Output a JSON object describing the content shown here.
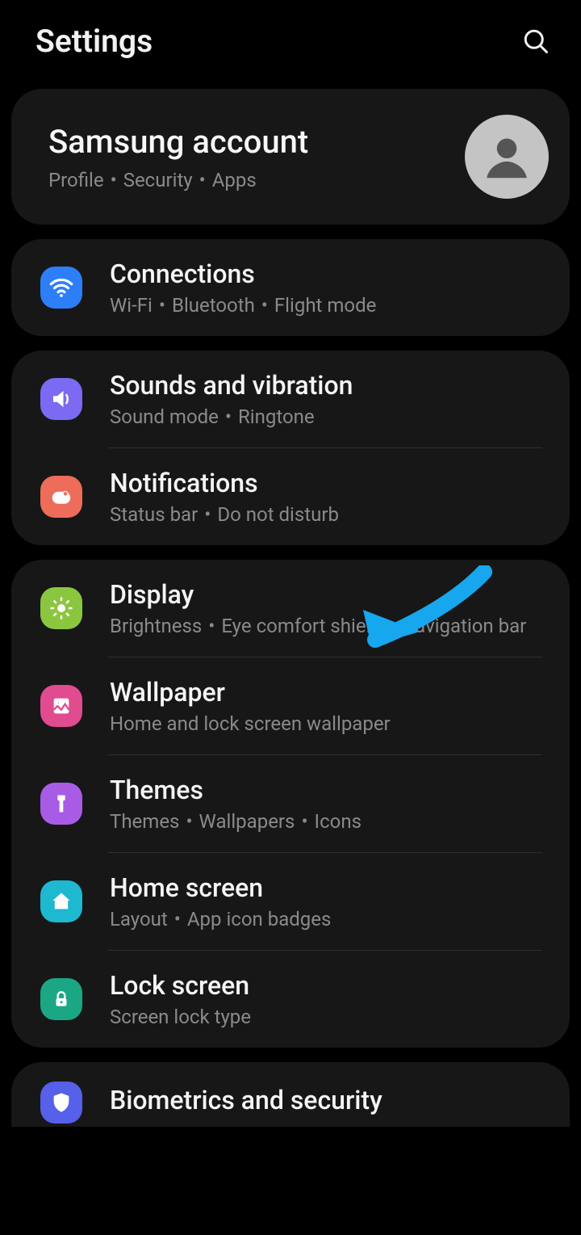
{
  "header": {
    "title": "Settings"
  },
  "account": {
    "title": "Samsung account",
    "subtitle_parts": [
      "Profile",
      "Security",
      "Apps"
    ]
  },
  "groups": [
    {
      "items": [
        {
          "icon": "wifi",
          "color": "#2d7ff9",
          "title": "Connections",
          "subtitle_parts": [
            "Wi-Fi",
            "Bluetooth",
            "Flight mode"
          ]
        }
      ]
    },
    {
      "items": [
        {
          "icon": "sound",
          "color": "#7a6bf2",
          "title": "Sounds and vibration",
          "subtitle_parts": [
            "Sound mode",
            "Ringtone"
          ]
        },
        {
          "icon": "notif",
          "color": "#ee6c5a",
          "title": "Notifications",
          "subtitle_parts": [
            "Status bar",
            "Do not disturb"
          ]
        }
      ]
    },
    {
      "items": [
        {
          "icon": "display",
          "color": "#8bc63f",
          "title": "Display",
          "subtitle_parts": [
            "Brightness",
            "Eye comfort shield",
            "Navigation bar"
          ]
        },
        {
          "icon": "wallpaper",
          "color": "#e14b8f",
          "title": "Wallpaper",
          "subtitle_parts": [
            "Home and lock screen wallpaper"
          ]
        },
        {
          "icon": "themes",
          "color": "#a85ce6",
          "title": "Themes",
          "subtitle_parts": [
            "Themes",
            "Wallpapers",
            "Icons"
          ]
        },
        {
          "icon": "home",
          "color": "#1fb8d1",
          "title": "Home screen",
          "subtitle_parts": [
            "Layout",
            "App icon badges"
          ]
        },
        {
          "icon": "lock",
          "color": "#1ba784",
          "title": "Lock screen",
          "subtitle_parts": [
            "Screen lock type"
          ]
        }
      ]
    },
    {
      "items": [
        {
          "icon": "biometrics",
          "color": "#5660e8",
          "title": "Biometrics and security",
          "subtitle_parts": []
        }
      ]
    }
  ]
}
